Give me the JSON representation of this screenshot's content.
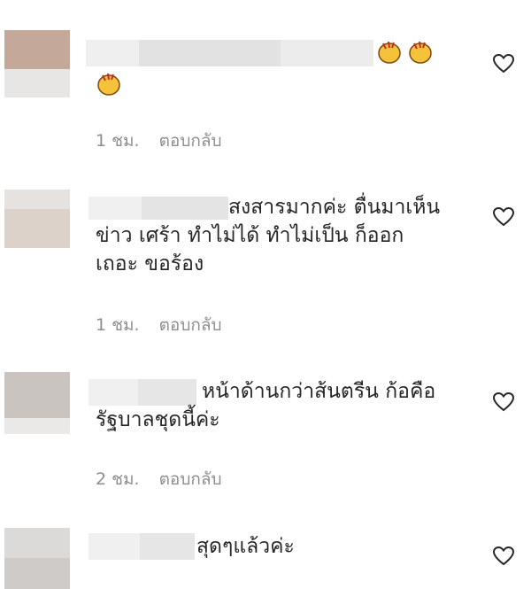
{
  "comments": [
    {
      "text": "",
      "emoji_inline": "clap-clap",
      "emoji_line2": "clap",
      "time": "1 ชม.",
      "reply": "ตอบกลับ"
    },
    {
      "text": "สงสารมากค่ะ ตื่นมาเห็น\nข่าว เศร้า ทำไม่ได้ ทำไม่เป็น ก็ออก\nเถอะ ขอร้อง",
      "time": "1 ชม.",
      "reply": "ตอบกลับ"
    },
    {
      "text": "หน้าด้านกว่าส้นตรีน ก้อคือ\nรัฐบาลชุดนี้ค่ะ",
      "time": "2 ชม.",
      "reply": "ตอบกลับ"
    },
    {
      "text": "สุดๆแล้วค่ะ"
    }
  ],
  "icons": {
    "like": "heart-outline-icon",
    "emoji": "clapping-hands-emoji"
  },
  "colors": {
    "text": "#262626",
    "meta": "#8e8e8e",
    "avatar1": "#c4a89a",
    "avatar2": "#dcd2ca",
    "avatar3": "#c9c4c0",
    "avatar4": "#d6d3d0"
  }
}
